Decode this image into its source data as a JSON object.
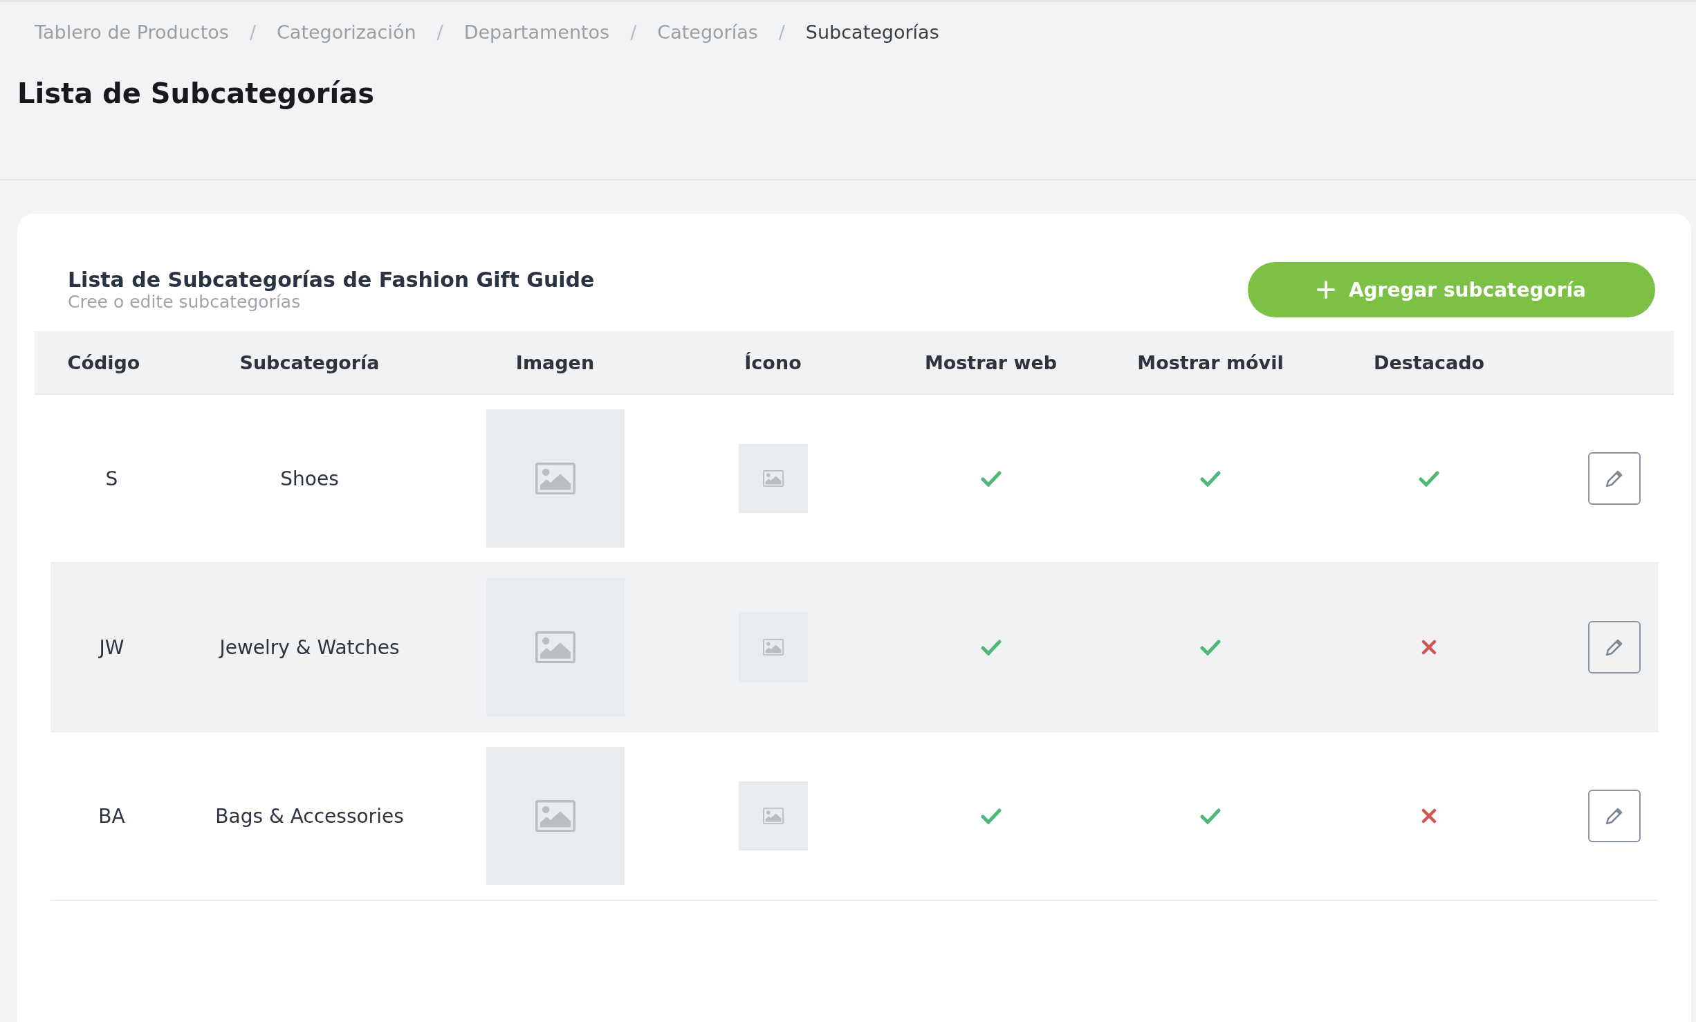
{
  "breadcrumb": [
    {
      "label": "Tablero de Productos",
      "current": false
    },
    {
      "separator": "/",
      "label": "Categorización",
      "current": false
    },
    {
      "separator": "/",
      "label": "Departamentos",
      "current": false
    },
    {
      "separator": "/",
      "label": "Categorías",
      "current": false
    },
    {
      "separator": "/",
      "label": "Subcategorías",
      "current": true
    }
  ],
  "page_title": "Lista de Subcategorías",
  "card": {
    "title": "Lista de Subcategorías de Fashion Gift Guide",
    "subtitle": "Cree o edite subcategorías",
    "add_button": "Agregar subcategoría"
  },
  "table": {
    "columns": [
      "Código",
      "Subcategoría",
      "Imagen",
      "Ícono",
      "Mostrar web",
      "Mostrar móvil",
      "Destacado"
    ],
    "rows": [
      {
        "code": "S",
        "name": "Shoes",
        "show_web": true,
        "show_mobile": true,
        "featured": true,
        "highlighted": false
      },
      {
        "code": "JW",
        "name": "Jewelry & Watches",
        "show_web": true,
        "show_mobile": true,
        "featured": false,
        "highlighted": true
      },
      {
        "code": "BA",
        "name": "Bags & Accessories",
        "show_web": true,
        "show_mobile": true,
        "featured": false,
        "highlighted": false
      }
    ]
  }
}
